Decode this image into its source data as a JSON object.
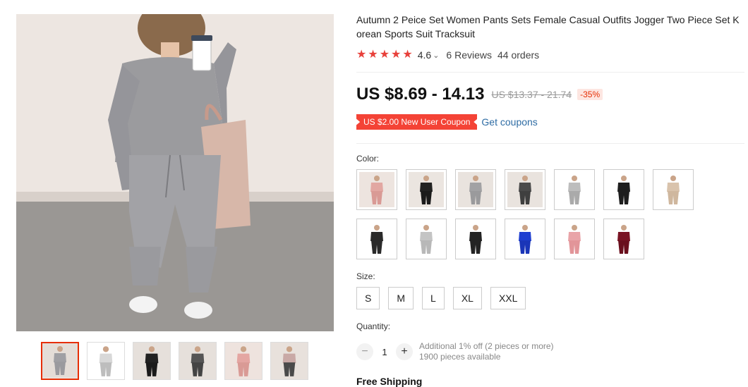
{
  "product": {
    "title": "Autumn 2 Peice Set Women Pants Sets Female Casual Outfits Jogger Two Piece Set Korean Sports Suit Tracksuit",
    "rating": 4.6,
    "rating_text": "4.6",
    "stars": 5,
    "reviews_text": "6 Reviews",
    "orders_text": "44 orders",
    "price": "US $8.69 - 14.13",
    "old_price": "US $13.37 - 21.74",
    "discount": "-35%",
    "coupon": "US $2.00 New User Coupon",
    "get_coupons": "Get coupons"
  },
  "icons": {
    "star": "star-icon",
    "chevron": "chevron-down-icon",
    "minus": "minus-icon",
    "plus": "plus-icon"
  },
  "colors_accent": {
    "price": "#111111",
    "star": "#e8413b",
    "coupon": "#f44336",
    "link": "#2e6ca4",
    "active_border": "#e62e04"
  },
  "gallery": {
    "thumbnails": [
      {
        "name": "grey-set",
        "active": true
      },
      {
        "name": "size-chart",
        "active": false
      },
      {
        "name": "black-set",
        "active": false
      },
      {
        "name": "dark-grey-set",
        "active": false
      },
      {
        "name": "pink-set",
        "active": false
      },
      {
        "name": "mixed-set",
        "active": false
      }
    ]
  },
  "options": {
    "color_label": "Color:",
    "colors": [
      {
        "name": "pink",
        "top": "#e2a7a2",
        "bottom": "#d99a95",
        "bg": "#ede4df"
      },
      {
        "name": "black",
        "top": "#222222",
        "bottom": "#1b1b1b",
        "bg": "#ebe5e0"
      },
      {
        "name": "grey",
        "top": "#a2a2a4",
        "bottom": "#9a9a9c",
        "bg": "#e9e3de"
      },
      {
        "name": "dark-grey",
        "top": "#4a4a4a",
        "bottom": "#3f3f3f",
        "bg": "#e9e3de"
      },
      {
        "name": "light-grey-short-sleeve",
        "top": "#bdbdbd",
        "bottom": "#aaaaaa",
        "bg": "#ffffff"
      },
      {
        "name": "black-short-sleeve",
        "top": "#1e1e1e",
        "bottom": "#1e1e1e",
        "bg": "#ffffff"
      },
      {
        "name": "khaki",
        "top": "#d9c3ac",
        "bottom": "#cfb79e",
        "bg": "#ffffff"
      },
      {
        "name": "black-tee",
        "top": "#2a2a2a",
        "bottom": "#2a2a2a",
        "bg": "#ffffff"
      },
      {
        "name": "light-grey-tank",
        "top": "#c4c4c4",
        "bottom": "#b8b8b8",
        "bg": "#ffffff"
      },
      {
        "name": "black-tank",
        "top": "#232323",
        "bottom": "#232323",
        "bg": "#ffffff"
      },
      {
        "name": "blue",
        "top": "#1f3fd1",
        "bottom": "#1a35b8",
        "bg": "#ffffff"
      },
      {
        "name": "pink-tee",
        "top": "#e9a4a8",
        "bottom": "#e29599",
        "bg": "#ffffff"
      },
      {
        "name": "burgundy",
        "top": "#7a1424",
        "bottom": "#6a0f1d",
        "bg": "#ffffff"
      }
    ],
    "size_label": "Size:",
    "sizes": [
      "S",
      "M",
      "L",
      "XL",
      "XXL"
    ],
    "quantity_label": "Quantity:",
    "quantity": "1",
    "quantity_note": "Additional 1% off (2 pieces or more)",
    "available": "1900 pieces available"
  },
  "shipping": "Free Shipping"
}
